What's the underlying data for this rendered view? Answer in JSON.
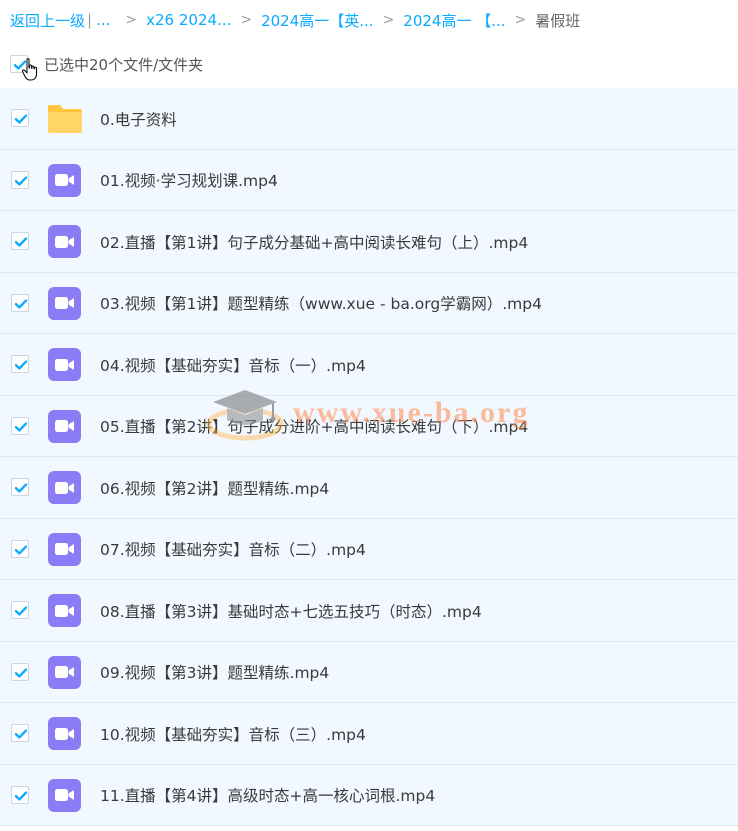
{
  "breadcrumb": {
    "back_label": "返回上一级",
    "separator": "|",
    "ellipsis": "...",
    "arrow": ">",
    "items": [
      {
        "label": "x26 2024..."
      },
      {
        "label": "2024高一【英..."
      },
      {
        "label": "2024高一 【..."
      }
    ],
    "current": "暑假班"
  },
  "selection": {
    "label": "已选中20个文件/文件夹",
    "checked": true
  },
  "files": [
    {
      "name": "0.电子资料",
      "type": "folder",
      "icon": "folder-icon",
      "checked": true
    },
    {
      "name": "01.视频·学习规划课.mp4",
      "type": "video",
      "icon": "video-icon",
      "checked": true
    },
    {
      "name": "02.直播【第1讲】句子成分基础+高中阅读长难句（上）.mp4",
      "type": "video",
      "icon": "video-icon",
      "checked": true
    },
    {
      "name": "03.视频【第1讲】题型精练（www.xue - ba.org学霸网）.mp4",
      "type": "video",
      "icon": "video-icon",
      "checked": true
    },
    {
      "name": "04.视频【基础夯实】音标（一）.mp4",
      "type": "video",
      "icon": "video-icon",
      "checked": true
    },
    {
      "name": "05.直播【第2讲】句子成分进阶+高中阅读长难句（下）.mp4",
      "type": "video",
      "icon": "video-icon",
      "checked": true
    },
    {
      "name": "06.视频【第2讲】题型精练.mp4",
      "type": "video",
      "icon": "video-icon",
      "checked": true
    },
    {
      "name": "07.视频【基础夯实】音标（二）.mp4",
      "type": "video",
      "icon": "video-icon",
      "checked": true
    },
    {
      "name": "08.直播【第3讲】基础时态+七选五技巧（时态）.mp4",
      "type": "video",
      "icon": "video-icon",
      "checked": true
    },
    {
      "name": "09.视频【第3讲】题型精练.mp4",
      "type": "video",
      "icon": "video-icon",
      "checked": true
    },
    {
      "name": "10.视频【基础夯实】音标（三）.mp4",
      "type": "video",
      "icon": "video-icon",
      "checked": true
    },
    {
      "name": "11.直播【第4讲】高级时态+高一核心词根.mp4",
      "type": "video",
      "icon": "video-icon",
      "checked": true
    }
  ],
  "watermark": {
    "text": "www.xue-ba.org",
    "icon": "graduation-cap-icon"
  },
  "colors": {
    "link": "#09aaff",
    "check": "#09aaff",
    "row_bg": "#f2f8ff",
    "row_border": "#dde8f3",
    "video_icon": "#8b7cf6",
    "folder_icon": "#ffc53d",
    "watermark": "#ff8a4c"
  }
}
